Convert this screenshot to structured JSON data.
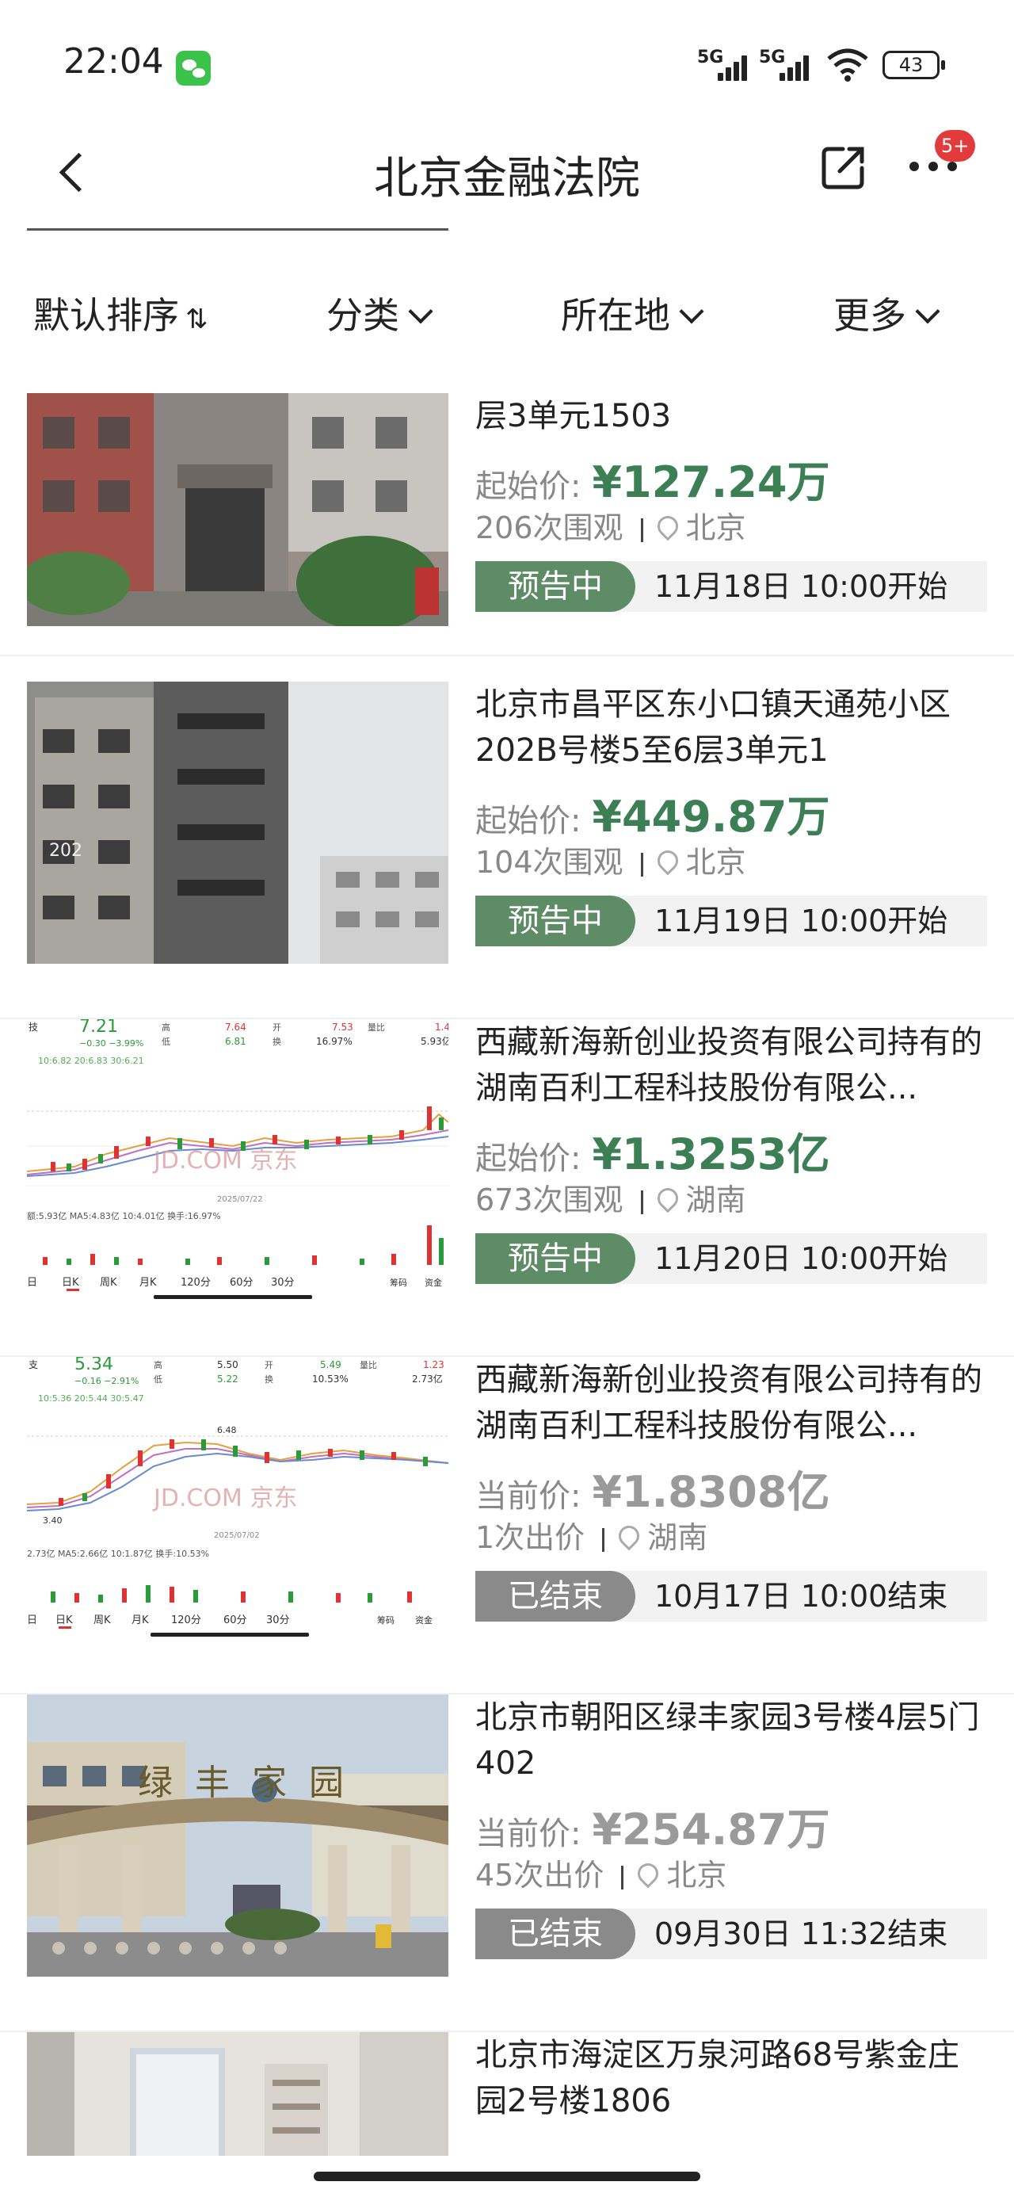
{
  "status_bar": {
    "time": "22:04",
    "network1": "5G",
    "network2": "5G",
    "battery": "43",
    "icons": [
      "wechat-icon",
      "signal-icon",
      "signal-icon",
      "wifi-icon",
      "battery-icon"
    ]
  },
  "nav": {
    "title": "北京金融法院",
    "badge": "5+",
    "icons": [
      "back-icon",
      "share-icon",
      "more-icon"
    ]
  },
  "filters": {
    "sort": "默认排序",
    "category": "分类",
    "location": "所在地",
    "more": "更多"
  },
  "colors": {
    "accent_green": "#3c7f55",
    "status_preview": "#5e8c66",
    "status_ended": "#8a8a8a",
    "badge_red": "#e23b3b"
  },
  "items": [
    {
      "name": "层3单元1503",
      "price_label": "起始价:",
      "price": "¥127.24万",
      "views": "206次围观",
      "location": "北京",
      "status": "预告中",
      "time": "11月18日 10:00开始"
    },
    {
      "name": "北京市昌平区东小口镇天通苑小区202B号楼5至6层3单元1",
      "price_label": "起始价:",
      "price": "¥449.87万",
      "views": "104次围观",
      "location": "北京",
      "status": "预告中",
      "time": "11月19日 10:00开始",
      "image_text": "202"
    },
    {
      "name": "西藏新海新创业投资有限公司持有的湖南百利工程科技股份有限公...",
      "price_label": "起始价:",
      "price": "¥1.3253亿",
      "views": "673次围观",
      "location": "湖南",
      "status": "预告中",
      "time": "11月20日 10:00开始",
      "image": {
        "price": "7.21",
        "change": "−0.30 −3.99%",
        "high_label": "高",
        "high": "7.64",
        "low_label": "低",
        "low": "6.81",
        "open_label": "开",
        "open": "7.53",
        "turn_label": "换",
        "turn": "16.97%",
        "vol_ratio_label": "量比",
        "vol_ratio": "1.4",
        "amount": "5.93亿",
        "ma": "10:6.82   20:6.83   30:6.21",
        "watermark": "JD.COM 京东",
        "date": "2025/07/22",
        "vol_line": "额:5.93亿  MA5:4.83亿  10:4.01亿  换手:16.97%",
        "tabs": [
          "日",
          "日K",
          "周K",
          "月K",
          "120分",
          "60分",
          "30分",
          "筹码",
          "资金"
        ]
      }
    },
    {
      "name": "西藏新海新创业投资有限公司持有的湖南百利工程科技股份有限公...",
      "price_label": "当前价:",
      "price": "¥1.8308亿",
      "views": "1次出价",
      "location": "湖南",
      "status": "已结束",
      "time": "10月17日 10:00结束",
      "image": {
        "price": "5.34",
        "change": "−0.16 −2.91%",
        "high_label": "高",
        "high": "5.50",
        "low_label": "低",
        "low": "5.22",
        "open_label": "开",
        "open": "5.49",
        "turn_label": "换",
        "turn": "10.53%",
        "vol_ratio_label": "量比",
        "vol_ratio": "1.23",
        "amount": "2.73亿",
        "ma": "10:5.36   20:5.44   30:5.47",
        "peak": "6.48",
        "trough": "3.40",
        "watermark": "JD.COM 京东",
        "date": "2025/07/02",
        "vol_line": "2.73亿  MA5:2.66亿  10:1.87亿  换手:10.53%",
        "tabs": [
          "日",
          "日K",
          "周K",
          "月K",
          "120分",
          "60分",
          "30分",
          "筹码",
          "资金"
        ]
      }
    },
    {
      "name": "北京市朝阳区绿丰家园3号楼4层5门402",
      "price_label": "当前价:",
      "price": "¥254.87万",
      "views": "45次出价",
      "location": "北京",
      "status": "已结束",
      "time": "09月30日 11:32结束",
      "image_text": "绿丰家园"
    },
    {
      "name": "北京市海淀区万泉河路68号紫金庄园2号楼1806"
    }
  ]
}
